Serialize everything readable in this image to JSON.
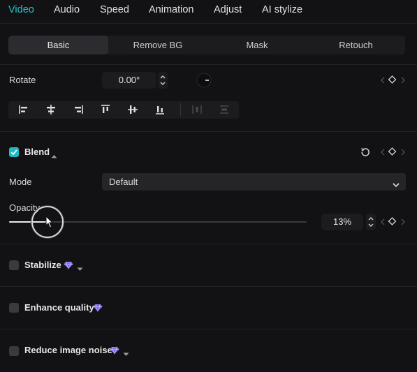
{
  "top_tabs": [
    "Video",
    "Audio",
    "Speed",
    "Animation",
    "Adjust",
    "AI stylize"
  ],
  "active_top_tab": "Video",
  "sub_tabs": [
    "Basic",
    "Remove BG",
    "Mask",
    "Retouch"
  ],
  "active_sub_tab": "Basic",
  "rotate": {
    "label": "Rotate",
    "value": "0.00°"
  },
  "align_icons": [
    "align-left-icon",
    "align-center-horizontal-icon",
    "align-right-icon",
    "align-top-icon",
    "align-center-vertical-icon",
    "align-bottom-icon",
    "distribute-horizontal-icon",
    "distribute-vertical-icon"
  ],
  "blend": {
    "label": "Blend",
    "checked": true,
    "mode_label": "Mode",
    "mode_value": "Default",
    "opacity_label": "Opacity",
    "opacity_value": "13%",
    "opacity_fraction": 0.13
  },
  "stabilize": {
    "label": "Stabilize",
    "checked": false
  },
  "enhance_quality": {
    "label": "Enhance quality",
    "checked": false
  },
  "reduce_noise": {
    "label": "Reduce image noise",
    "checked": false
  },
  "colors": {
    "accent": "#20c4cc",
    "premium": "#8a6cf0",
    "background": "#121214"
  }
}
